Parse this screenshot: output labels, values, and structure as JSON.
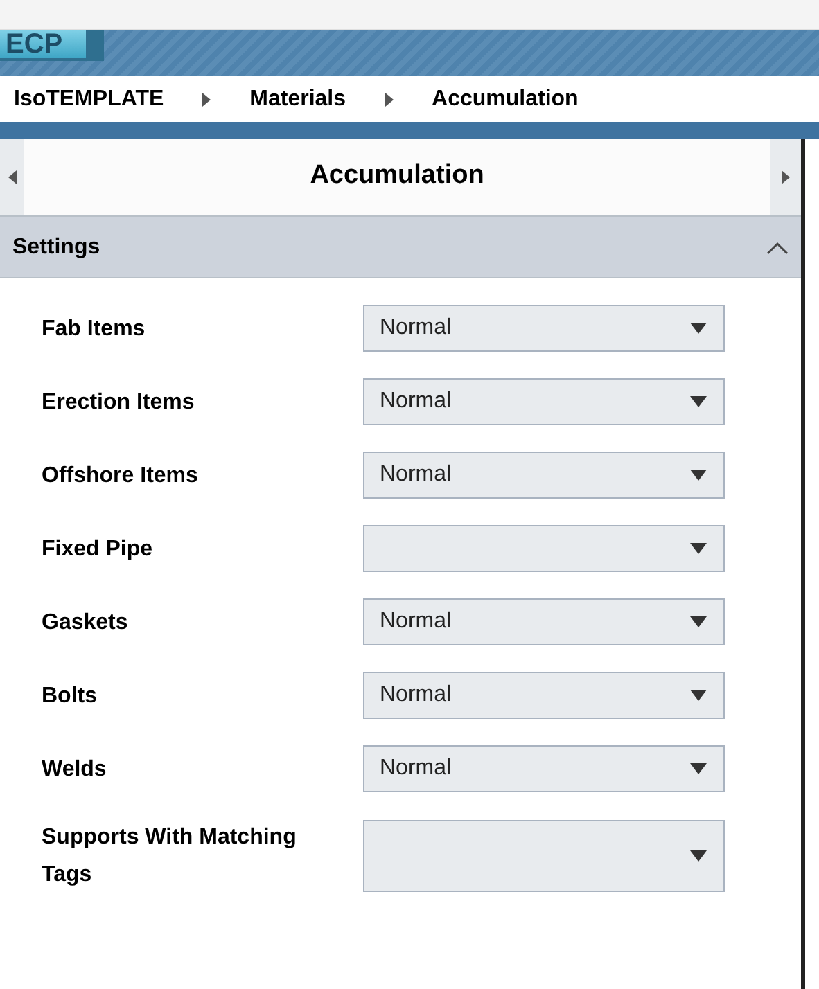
{
  "logo": {
    "text": "ECP"
  },
  "breadcrumb": [
    {
      "label": "IsoTEMPLATE"
    },
    {
      "label": "Materials"
    },
    {
      "label": "Accumulation"
    }
  ],
  "page_title": "Accumulation",
  "section": {
    "title": "Settings",
    "expanded": true
  },
  "fields": [
    {
      "label": "Fab Items",
      "value": "Normal"
    },
    {
      "label": "Erection Items",
      "value": "Normal"
    },
    {
      "label": "Offshore Items",
      "value": "Normal"
    },
    {
      "label": "Fixed Pipe"
    },
    {
      "label": "Gaskets",
      "value": "Normal"
    },
    {
      "label": "Bolts",
      "value": "Normal"
    },
    {
      "label": "Welds",
      "value": "Normal"
    },
    {
      "label": "Supports With Matching Tags"
    }
  ]
}
